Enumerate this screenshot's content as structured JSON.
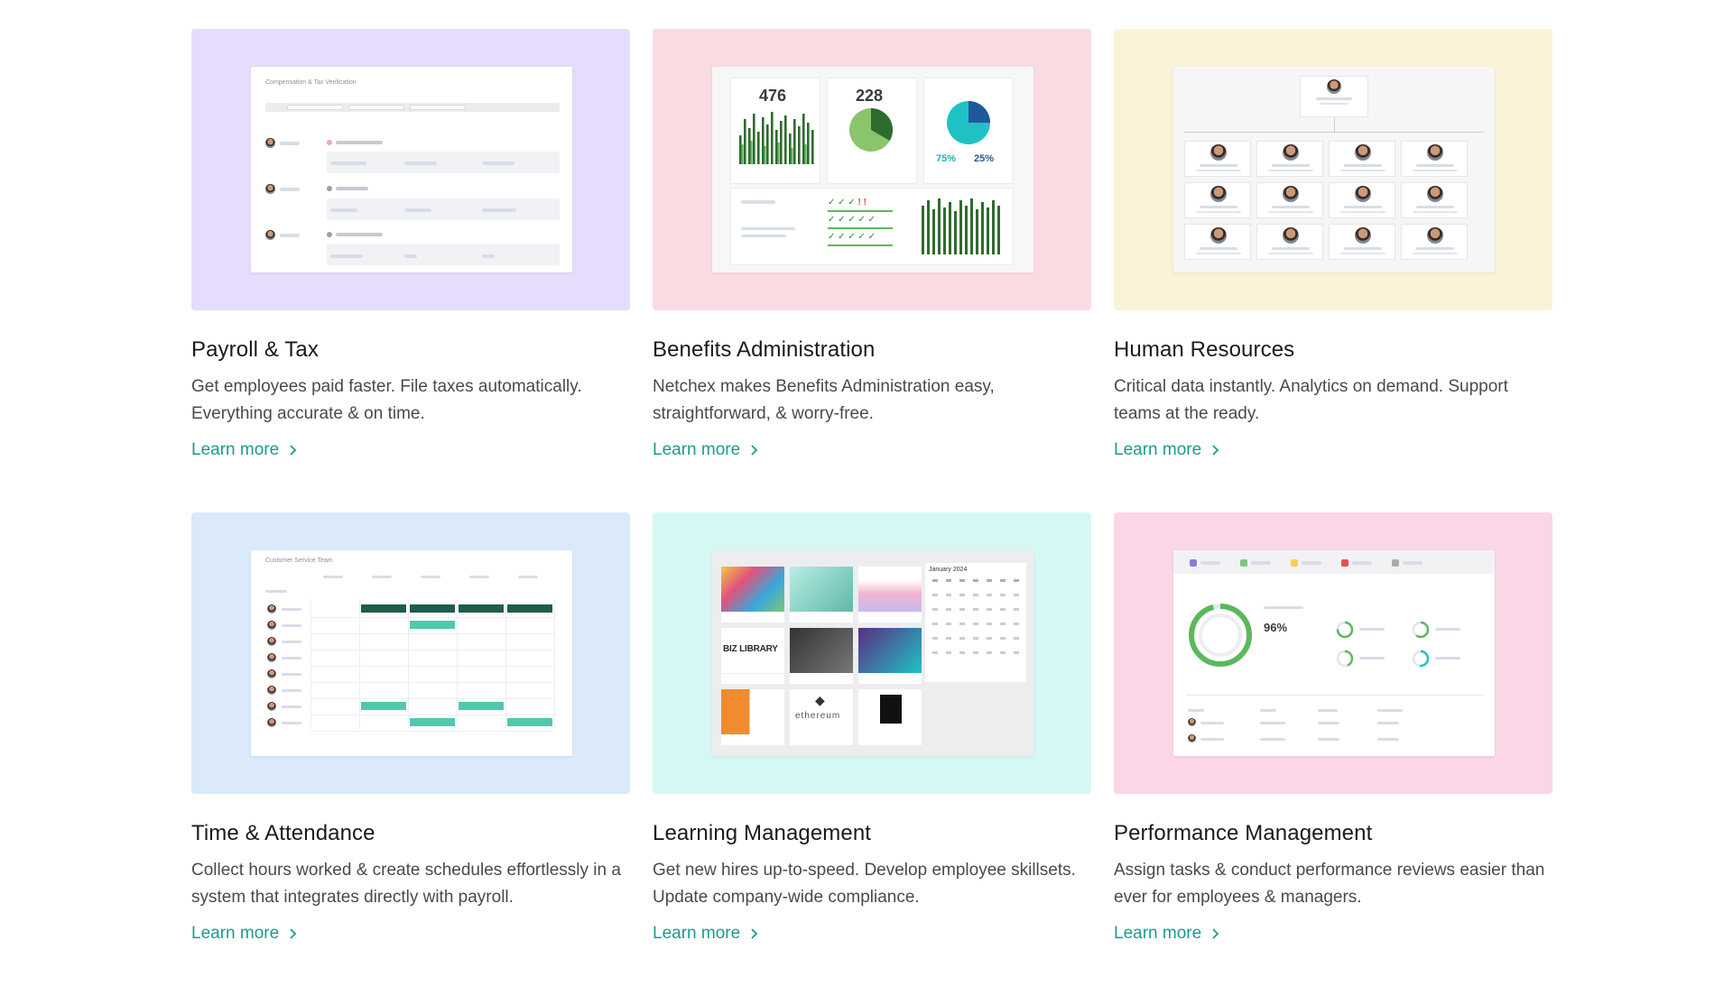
{
  "cards": [
    {
      "title": "Payroll & Tax",
      "description": "Get employees paid faster. File taxes automatically. Everything accurate & on time.",
      "link": "Learn more",
      "bg": "#e6dcfb",
      "preview_title": "Compensation & Tax Verification"
    },
    {
      "title": "Benefits Administration",
      "description": "Netchex makes Benefits Administration easy, straightforward, & worry-free.",
      "link": "Learn more",
      "bg": "#fadbe2",
      "stat1": "476",
      "stat2": "228",
      "pct1": "75%",
      "pct2": "25%"
    },
    {
      "title": "Human Resources",
      "description": "Critical data instantly. Analytics on demand. Support teams at the ready.",
      "link": "Learn more",
      "bg": "#faf3d7"
    },
    {
      "title": "Time & Attendance",
      "description": "Collect hours worked & create schedules effortlessly in a system that integrates directly with payroll.",
      "link": "Learn more",
      "bg": "#daeafa",
      "preview_title": "Customer Service Team"
    },
    {
      "title": "Learning Management",
      "description": "Get new hires up-to-speed. Develop employee skillsets. Update company-wide compliance.",
      "link": "Learn more",
      "bg": "#d6f8f5",
      "calendar_title": "January 2024",
      "biz_label": "BIZ LIBRARY",
      "eth_label": "ethereum"
    },
    {
      "title": "Performance Management",
      "description": "Assign tasks & conduct performance reviews easier than ever for employees & managers.",
      "link": "Learn more",
      "bg": "#fad6e6",
      "score": "96%"
    }
  ],
  "colors": {
    "link": "#1a9c8c",
    "green_dark": "#2e6b2e",
    "teal": "#1fc2c4",
    "mint": "#4fc9ad"
  }
}
